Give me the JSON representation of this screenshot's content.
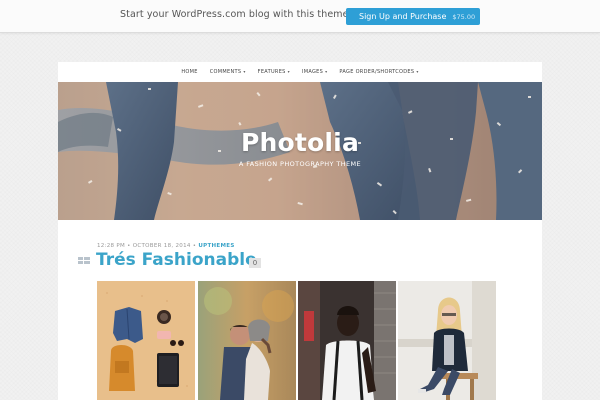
{
  "promo": {
    "text": "Start your WordPress.com blog with this theme.",
    "button_label": "Sign Up and Purchase",
    "price": "$75.00"
  },
  "nav": {
    "items": [
      {
        "label": "HOME",
        "has_submenu": false
      },
      {
        "label": "COMMENTS",
        "has_submenu": true
      },
      {
        "label": "FEATURES",
        "has_submenu": true
      },
      {
        "label": "IMAGES",
        "has_submenu": true
      },
      {
        "label": "PAGE ORDER/SHORTCODES",
        "has_submenu": true
      }
    ],
    "caret": "▾"
  },
  "hero": {
    "title": "Photolia",
    "subtitle": "A FASHION PHOTOGRAPHY THEME"
  },
  "post": {
    "time": "12:28 PM",
    "separator": "•",
    "date": "OCTOBER 18, 2014",
    "author": "UPTHEMES",
    "title": "Trés Fashionable",
    "comment_count": "0"
  },
  "colors": {
    "accent": "#3ba4c9",
    "button": "#2e9fd6",
    "background": "#f1f1f1"
  },
  "icons": {
    "post_format": "gallery-icon",
    "submenu": "caret-down-icon"
  }
}
